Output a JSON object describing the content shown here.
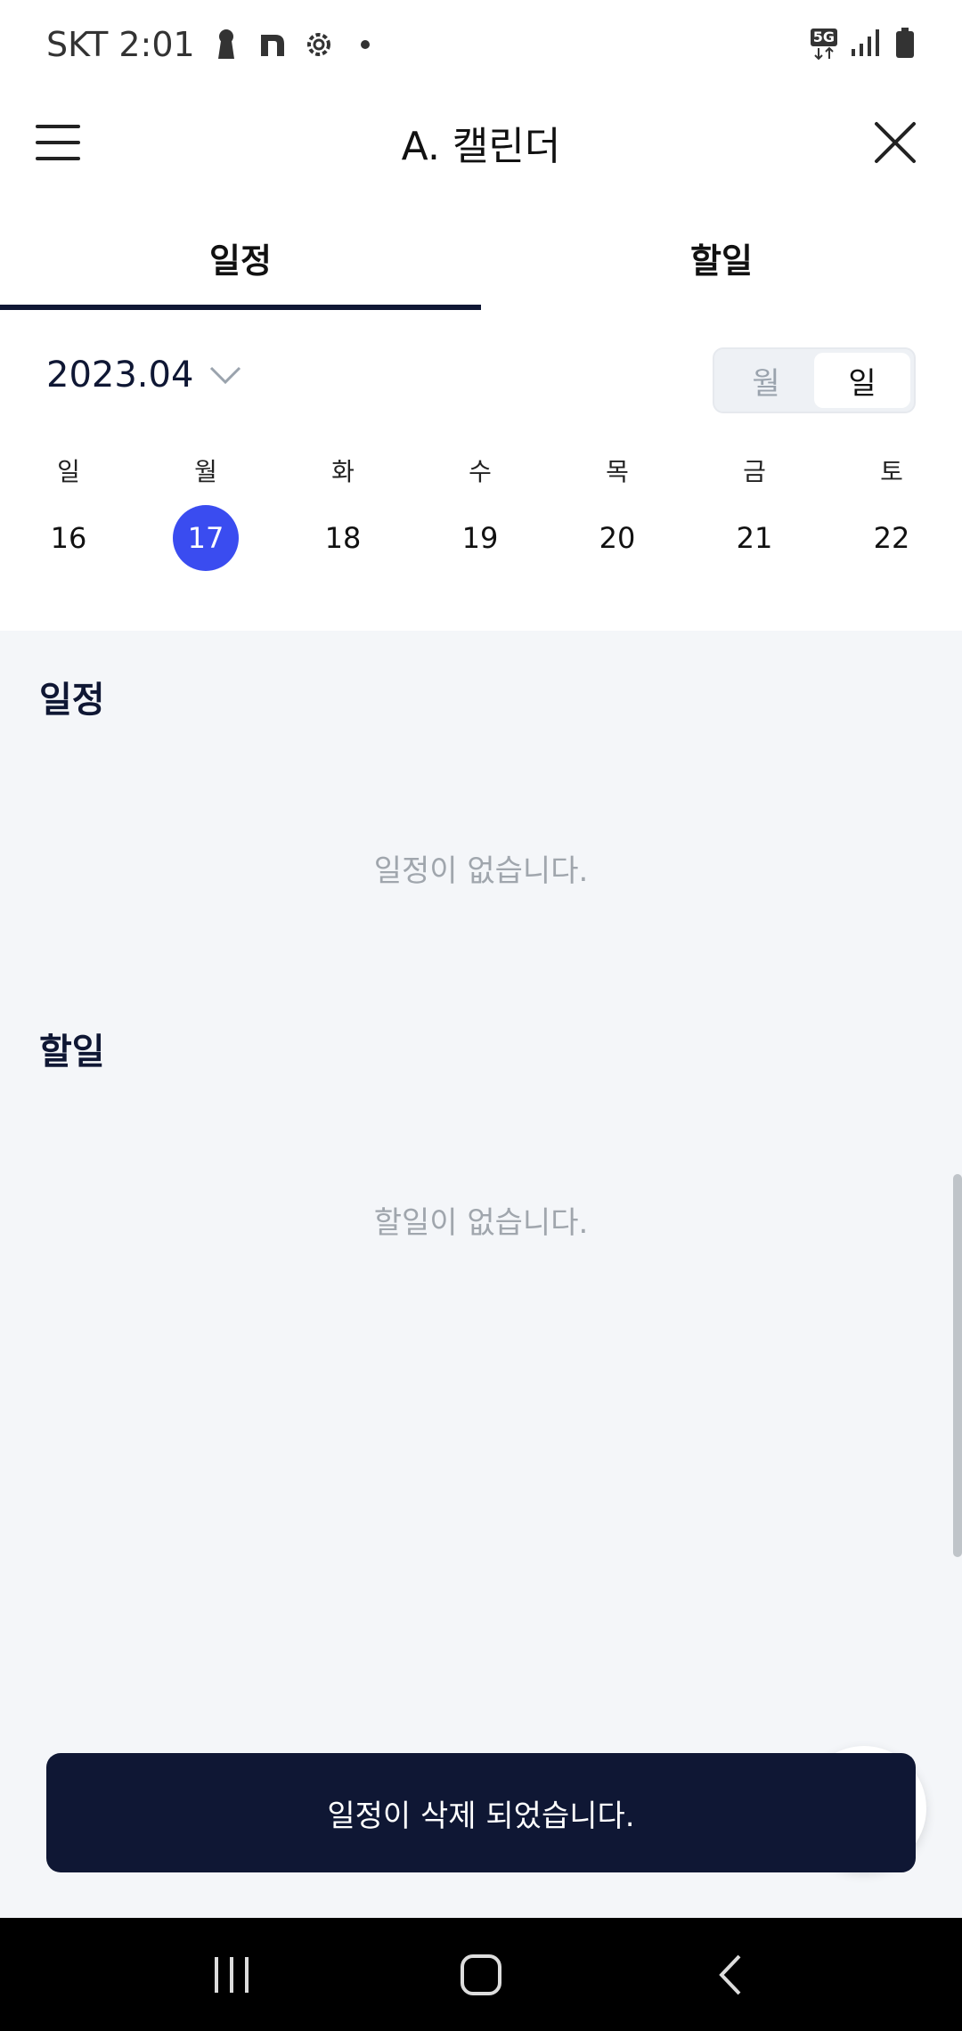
{
  "status_bar": {
    "carrier_time": "SKT 2:01",
    "network": "5G",
    "icons": [
      "keyhole-icon",
      "naver-n-icon",
      "settings-icon",
      "dot-icon",
      "5g-icon",
      "signal-icon",
      "battery-icon"
    ]
  },
  "app_bar": {
    "title": "A. 캘린더"
  },
  "tabs": [
    {
      "label": "일정",
      "active": true
    },
    {
      "label": "할일",
      "active": false
    }
  ],
  "month_selector": {
    "label": "2023.04"
  },
  "view_toggle": {
    "options": [
      {
        "label": "월",
        "active": false
      },
      {
        "label": "일",
        "active": true
      }
    ]
  },
  "week": {
    "day_names": [
      "일",
      "월",
      "화",
      "수",
      "목",
      "금",
      "토"
    ],
    "dates": [
      "16",
      "17",
      "18",
      "19",
      "20",
      "21",
      "22"
    ],
    "selected_index": 1
  },
  "sections": {
    "schedule": {
      "title": "일정",
      "empty_text": "일정이 없습니다."
    },
    "todo": {
      "title": "할일",
      "empty_text": "할일이 없습니다."
    }
  },
  "snackbar": {
    "message": "일정이 삭제 되었습니다."
  },
  "colors": {
    "navy": "#0f1734",
    "selected_day": "#3a4cf0",
    "content_bg": "#f4f6f9",
    "muted_text": "#a0a6ad"
  }
}
